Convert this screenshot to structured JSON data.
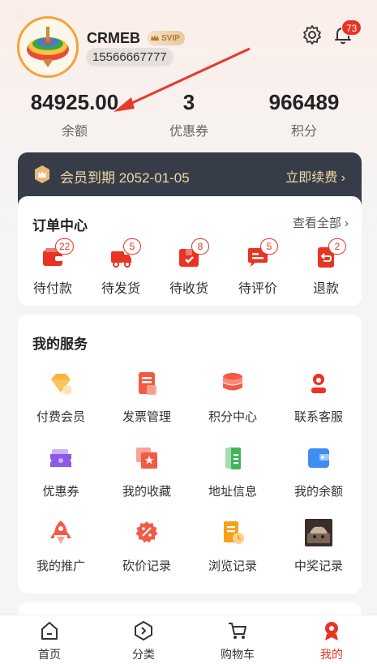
{
  "profile": {
    "nickname": "CRMEB",
    "vip_badge": "SVIP",
    "phone": "15566667777",
    "notification_count": "73"
  },
  "stats": [
    {
      "value": "84925.00",
      "label": "余额"
    },
    {
      "value": "3",
      "label": "优惠券"
    },
    {
      "value": "966489",
      "label": "积分"
    }
  ],
  "member": {
    "text": "会员到期 2052-01-05",
    "renew_label": "立即续费"
  },
  "orders": {
    "title": "订单中心",
    "see_all": "查看全部",
    "items": [
      {
        "label": "待付款",
        "count": "22",
        "icon": "wallet-icon"
      },
      {
        "label": "待发货",
        "count": "5",
        "icon": "truck-icon"
      },
      {
        "label": "待收货",
        "count": "8",
        "icon": "package-icon"
      },
      {
        "label": "待评价",
        "count": "5",
        "icon": "comment-icon"
      },
      {
        "label": "退款",
        "count": "2",
        "icon": "refund-icon"
      }
    ]
  },
  "services": {
    "title": "我的服务",
    "items": [
      {
        "label": "付费会员",
        "icon": "diamond-icon"
      },
      {
        "label": "发票管理",
        "icon": "invoice-icon"
      },
      {
        "label": "积分中心",
        "icon": "coins-icon"
      },
      {
        "label": "联系客服",
        "icon": "customer-service-icon"
      },
      {
        "label": "优惠券",
        "icon": "coupon-icon"
      },
      {
        "label": "我的收藏",
        "icon": "favorite-icon"
      },
      {
        "label": "地址信息",
        "icon": "address-icon"
      },
      {
        "label": "我的余额",
        "icon": "balance-icon"
      },
      {
        "label": "我的推广",
        "icon": "rocket-icon"
      },
      {
        "label": "砍价记录",
        "icon": "bargain-icon"
      },
      {
        "label": "浏览记录",
        "icon": "history-icon"
      },
      {
        "label": "中奖记录",
        "icon": "lottery-icon"
      }
    ]
  },
  "tabbar": [
    {
      "label": "首页",
      "icon": "home-icon"
    },
    {
      "label": "分类",
      "icon": "category-icon"
    },
    {
      "label": "购物车",
      "icon": "cart-icon"
    },
    {
      "label": "我的",
      "icon": "user-icon",
      "active": true
    }
  ],
  "colors": {
    "accent": "#e93323",
    "member_bar": "#373d48",
    "member_gold": "#f1d7a6"
  }
}
